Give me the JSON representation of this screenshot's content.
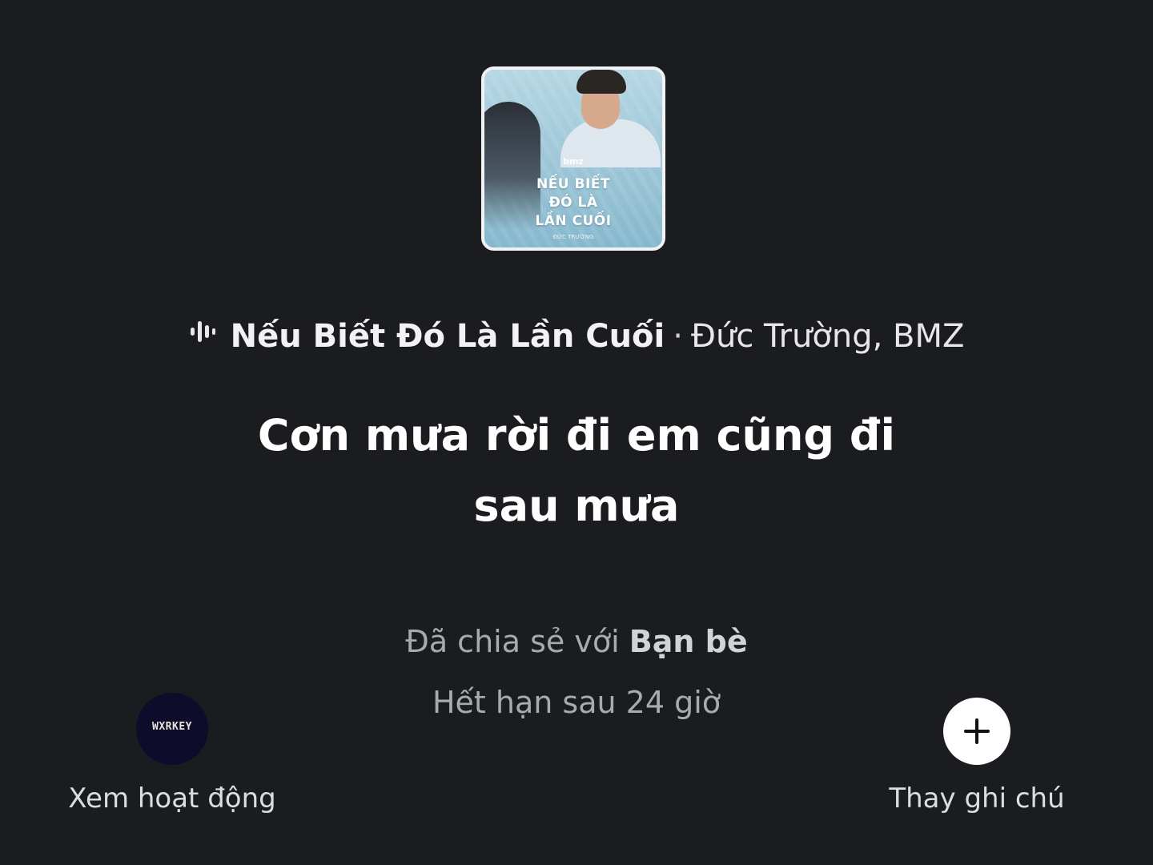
{
  "song": {
    "title": "Nếu Biết Đó Là Lần Cuối",
    "separator": "·",
    "artists": "Đức Trường, BMZ"
  },
  "album_art": {
    "brand": "bmz",
    "title": "NẾU BIẾT ĐÓ LÀ LẦN CUỐI",
    "subtitle": "ĐỨC TRƯỜNG"
  },
  "note": {
    "text": "Cơn mưa rời đi em cũng đi sau mưa"
  },
  "sharing": {
    "prefix": "Đã chia sẻ với",
    "audience": "Bạn bè",
    "expiry": "Hết hạn sau 24 giờ"
  },
  "activity": {
    "avatar_text": "WXRKEY",
    "label": "Xem hoạt động"
  },
  "change_note": {
    "label": "Thay ghi chú"
  },
  "colors": {
    "background": "#1b1c20",
    "primary_text": "#ffffff",
    "secondary_text": "#a9aab0",
    "avatar_bg": "#0d0c2b"
  }
}
